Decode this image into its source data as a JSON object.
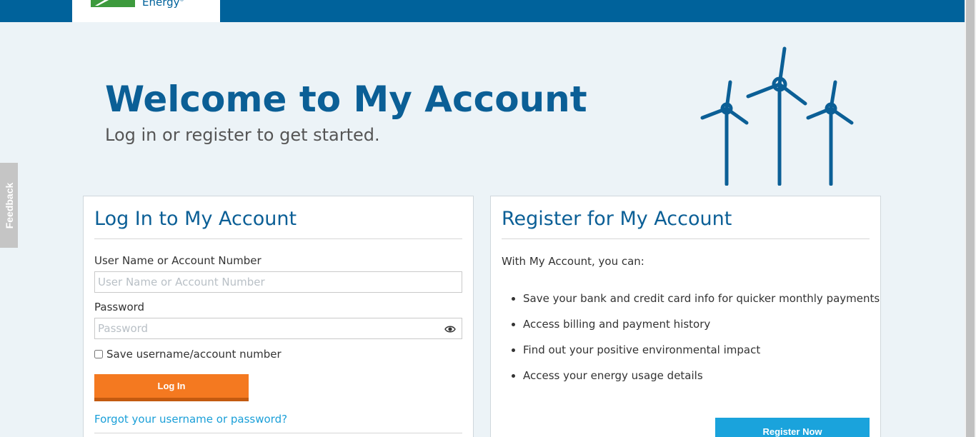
{
  "header": {
    "logo_text": "Energy",
    "logo_mark": "®"
  },
  "feedback": {
    "label": "Feedback"
  },
  "hero": {
    "title": "Welcome to My Account",
    "subtitle": "Log in or register to get started."
  },
  "login": {
    "title": "Log In to My Account",
    "username_label": "User Name or Account Number",
    "username_placeholder": "User Name or Account Number",
    "username_value": "",
    "password_label": "Password",
    "password_placeholder": "Password",
    "password_value": "",
    "remember_label": "Save username/account number",
    "remember_checked": false,
    "login_button": "Log In",
    "forgot_link": "Forgot your username or password?"
  },
  "register": {
    "title": "Register for My Account",
    "intro": "With My Account, you can:",
    "benefits": [
      "Save your bank and credit card info for quicker monthly payments",
      "Access billing and payment history",
      "Find out your positive environmental impact",
      "Access your energy usage details"
    ],
    "register_button": "Register Now"
  },
  "colors": {
    "brand_blue": "#00629b",
    "title_blue": "#0b5f96",
    "login_orange": "#f47920",
    "register_blue": "#1aa3dc",
    "link_blue": "#1a9fd8",
    "page_bg": "#ecf3f7"
  },
  "icons": [
    "logo-icon",
    "feedback-tab",
    "wind-turbines-illustration",
    "eye-icon",
    "bullet-icon"
  ]
}
